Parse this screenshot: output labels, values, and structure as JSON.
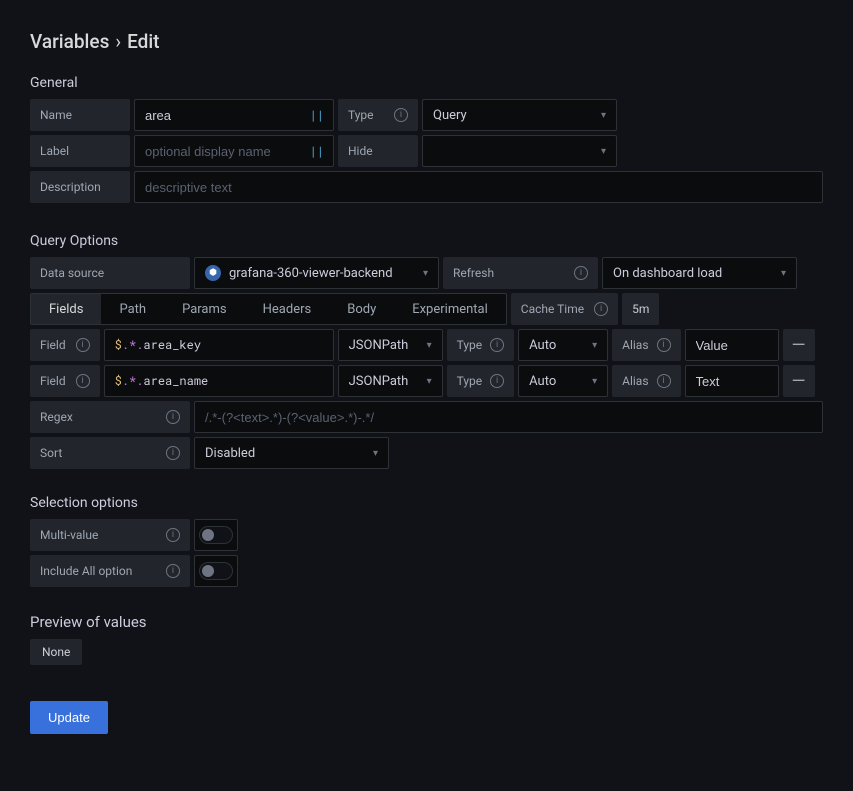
{
  "page": {
    "title_a": "Variables",
    "title_b": "Edit"
  },
  "sections": {
    "general": "General",
    "query": "Query Options",
    "selection": "Selection options",
    "preview": "Preview of values"
  },
  "labels": {
    "name": "Name",
    "type": "Type",
    "label": "Label",
    "hide": "Hide",
    "description": "Description",
    "data_source": "Data source",
    "refresh": "Refresh",
    "cache_time": "Cache Time",
    "field": "Field",
    "type2": "Type",
    "alias": "Alias",
    "regex": "Regex",
    "sort": "Sort",
    "multi_value": "Multi-value",
    "include_all": "Include All option"
  },
  "general": {
    "name_value": "area",
    "type_value": "Query",
    "label_placeholder": "optional display name",
    "hide_value": "",
    "description_placeholder": "descriptive text"
  },
  "query": {
    "data_source": "grafana-360-viewer-backend",
    "refresh": "On dashboard load",
    "cache_time": "5m",
    "tabs": [
      "Fields",
      "Path",
      "Params",
      "Headers",
      "Body",
      "Experimental"
    ],
    "active_tab": 0,
    "fields": [
      {
        "expr": "$.*.area_key",
        "lang": "JSONPath",
        "type": "Auto",
        "alias": "Value"
      },
      {
        "expr": "$.*.area_name",
        "lang": "JSONPath",
        "type": "Auto",
        "alias": "Text"
      }
    ],
    "regex_placeholder": "/.*-(?<text>.*)-(?<value>.*)-.*/",
    "sort_value": "Disabled"
  },
  "selection": {
    "multi_value": false,
    "include_all": false
  },
  "preview": {
    "values": [
      "None"
    ]
  },
  "buttons": {
    "update": "Update"
  }
}
